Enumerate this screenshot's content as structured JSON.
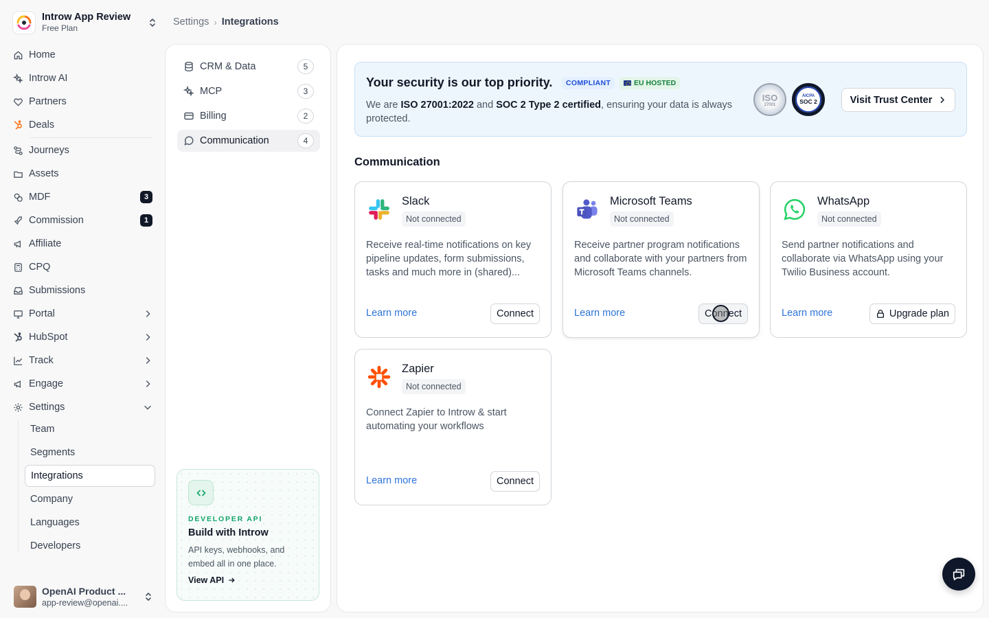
{
  "workspace": {
    "name": "Introw App Review",
    "plan": "Free Plan"
  },
  "nav": {
    "home": "Home",
    "ai": "Introw AI",
    "partners": "Partners",
    "deals": "Deals",
    "journeys": "Journeys",
    "assets": "Assets",
    "mdf": "MDF",
    "mdf_badge": "3",
    "commission": "Commission",
    "commission_badge": "1",
    "affiliate": "Affiliate",
    "cpq": "CPQ",
    "submissions": "Submissions",
    "portal": "Portal",
    "hubspot": "HubSpot",
    "track": "Track",
    "engage": "Engage",
    "settings": "Settings",
    "settings_sub": [
      "Team",
      "Segments",
      "Integrations",
      "Company",
      "Languages",
      "Developers"
    ]
  },
  "user": {
    "name": "OpenAI Product ...",
    "email": "app-review@openai...."
  },
  "breadcrumb": {
    "root": "Settings",
    "sep": "›",
    "current": "Integrations"
  },
  "categories": [
    {
      "label": "CRM & Data",
      "count": "5"
    },
    {
      "label": "MCP",
      "count": "3"
    },
    {
      "label": "Billing",
      "count": "2"
    },
    {
      "label": "Communication",
      "count": "4",
      "active": true
    }
  ],
  "developer": {
    "kicker": "DEVELOPER API",
    "title": "Build with Introw",
    "desc": "API keys, webhooks, and embed all in one place.",
    "link": "View API"
  },
  "security": {
    "title": "Your security is our top priority.",
    "pill_compliant": "COMPLIANT",
    "pill_eu": "EU HOSTED",
    "desc_1": "We are ",
    "desc_iso": "ISO 27001:2022",
    "desc_2": " and ",
    "desc_soc": "SOC 2 Type 2 certified",
    "desc_3": ", ensuring your data is always protected.",
    "badge_iso_big": "ISO",
    "badge_iso_small": "27001",
    "badge_soc_top": "AICPA",
    "badge_soc_bottom": "SOC 2",
    "trust_button": "Visit Trust Center"
  },
  "section_title": "Communication",
  "integrations": [
    {
      "name": "Slack",
      "status": "Not connected",
      "desc": "Receive real-time notifications on key pipeline updates, form submissions, tasks and much more in (shared)...",
      "learn": "Learn more",
      "action": "Connect"
    },
    {
      "name": "Microsoft Teams",
      "status": "Not connected",
      "desc": "Receive partner program notifications and collaborate with your partners from Microsoft Teams channels.",
      "learn": "Learn more",
      "action": "Connect"
    },
    {
      "name": "WhatsApp",
      "status": "Not connected",
      "desc": "Send partner notifications and collaborate via WhatsApp using your Twilio Business account.",
      "learn": "Learn more",
      "action": "Upgrade plan"
    },
    {
      "name": "Zapier",
      "status": "Not connected",
      "desc": "Connect Zapier to Introw & start automating your workflows",
      "learn": "Learn more",
      "action": "Connect"
    }
  ],
  "colors": {
    "link": "#2f73d9",
    "accent_green": "#10a36a",
    "security_bg": "#eef6fd"
  }
}
